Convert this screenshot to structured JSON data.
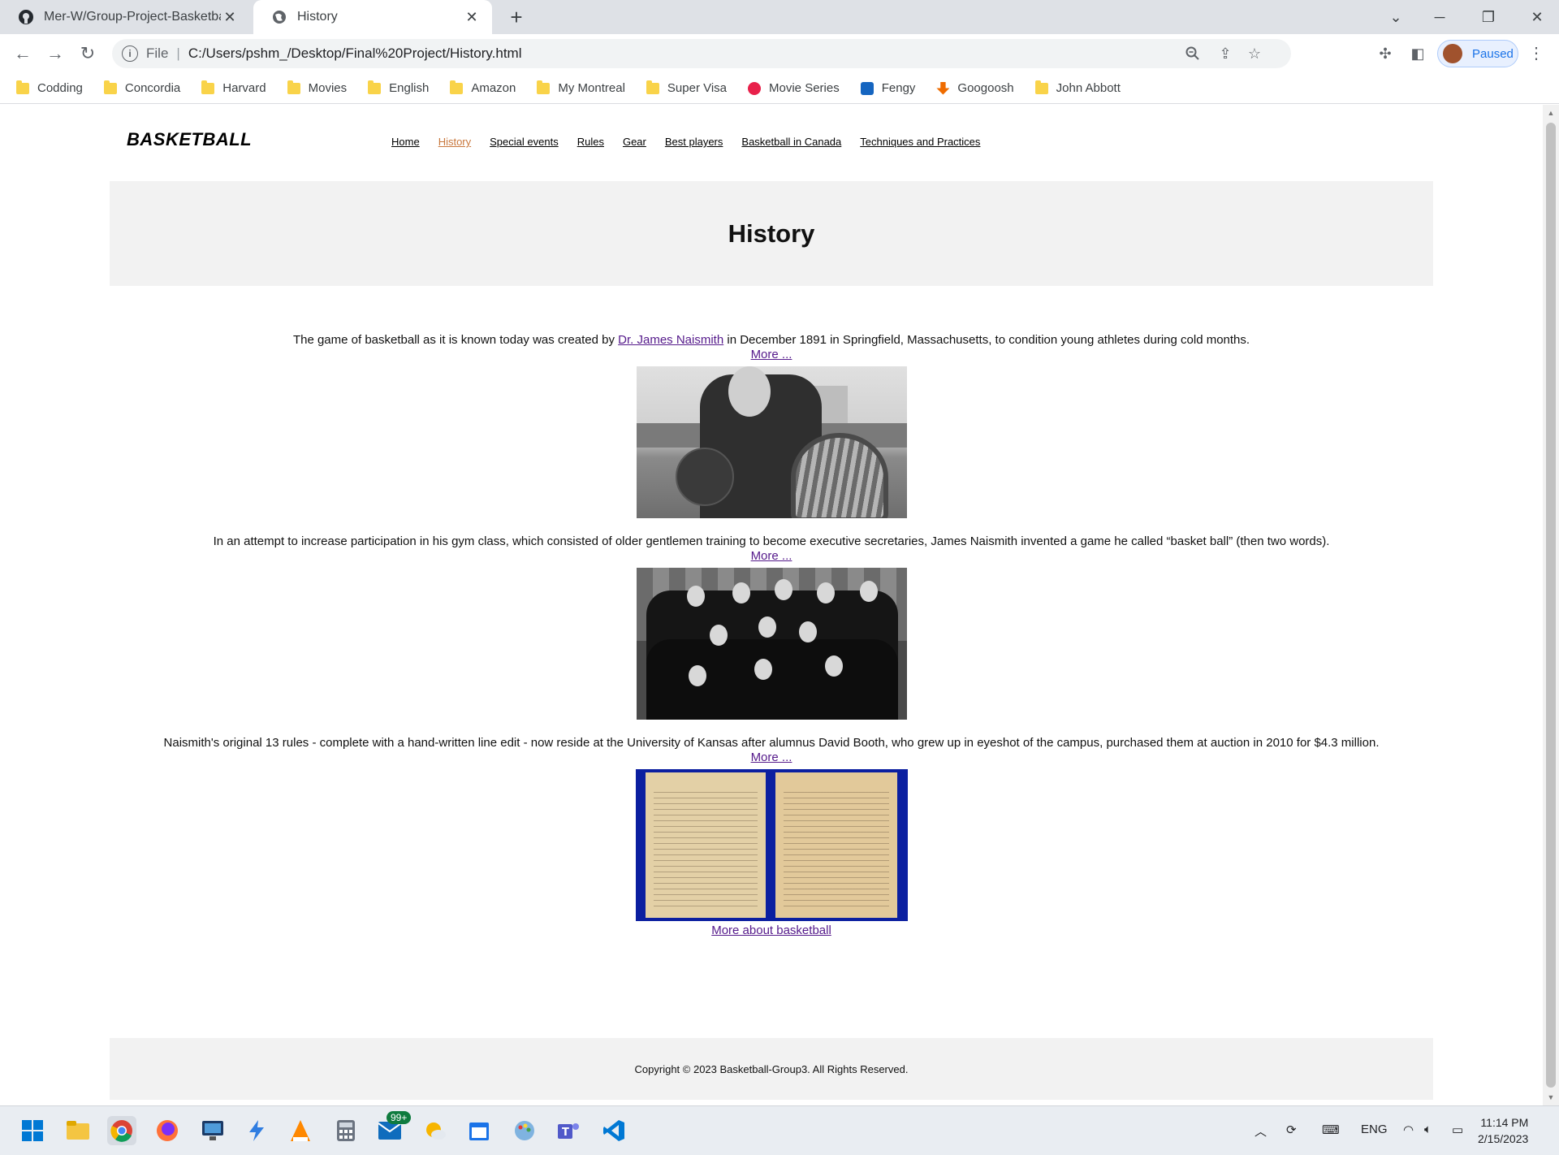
{
  "browser": {
    "tabs": [
      {
        "title": "Mer-W/Group-Project-Basketball",
        "active": false
      },
      {
        "title": "History",
        "active": true
      }
    ],
    "url_scheme": "File",
    "url": "C:/Users/pshm_/Desktop/Final%20Project/History.html",
    "profile_label": "Paused",
    "bookmarks": [
      "Codding",
      "Concordia",
      "Harvard",
      "Movies",
      "English",
      "Amazon",
      "My Montreal",
      "Super Visa",
      "Movie Series",
      "Fengy",
      "Googoosh",
      "John Abbott"
    ]
  },
  "site": {
    "logo": "BASKETBALL",
    "nav": [
      "Home",
      "History",
      "Special events",
      "Rules",
      "Gear",
      "Best players",
      "Basketball in Canada",
      "Techniques and Practices"
    ],
    "current_nav": "History",
    "page_title": "History",
    "sections": [
      {
        "text_before": "The game of basketball as it is known today was created by ",
        "link": "Dr. James Naismith",
        "text_after": " in December 1891 in Springfield, Massachusetts, to condition young athletes during cold months.",
        "more": "More ..."
      },
      {
        "text": "In an attempt to increase participation in his gym class, which consisted of older gentlemen training to become executive secretaries, James Naismith invented a game he called “basket ball” (then two words).",
        "more": "More ..."
      },
      {
        "text": "Naismith's original 13 rules - complete with a hand-written line edit - now reside at the University of Kansas after alumnus David Booth, who grew up in eyeshot of the campus, purchased them at auction in 2010 for $4.3 million.",
        "more": "More ..."
      }
    ],
    "more_about": "More about basketball",
    "footer": "Copyright © 2023 Basketball-Group3. All Rights Reserved."
  },
  "taskbar": {
    "mail_badge": "99+",
    "language": "ENG",
    "time": "11:14 PM",
    "date": "2/15/2023"
  },
  "colors": {
    "nav_current": "#c8773c",
    "visited_link": "#551a8b",
    "hero_bg": "#f2f2f2"
  }
}
